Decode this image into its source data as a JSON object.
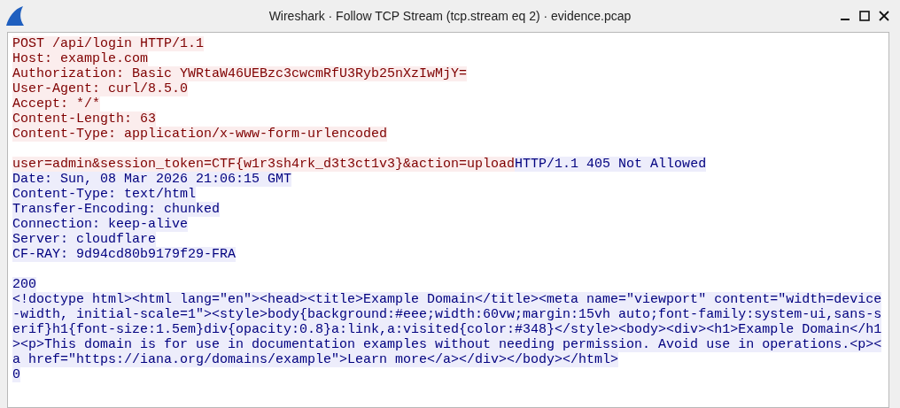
{
  "window": {
    "title": "Wireshark · Follow TCP Stream (tcp.stream eq 2) · evidence.pcap"
  },
  "stream": {
    "lines": [
      {
        "kind": "text",
        "segments": [
          {
            "kind": "client",
            "text": "POST /api/login HTTP/1.1"
          }
        ]
      },
      {
        "kind": "text",
        "segments": [
          {
            "kind": "client",
            "text": "Host: example.com"
          }
        ]
      },
      {
        "kind": "text",
        "segments": [
          {
            "kind": "client",
            "text": "Authorization: Basic YWRtaW46UEBzc3cwcmRfU3Ryb25nXzIwMjY="
          }
        ]
      },
      {
        "kind": "text",
        "segments": [
          {
            "kind": "client",
            "text": "User-Agent: curl/8.5.0"
          }
        ]
      },
      {
        "kind": "text",
        "segments": [
          {
            "kind": "client",
            "text": "Accept: */*"
          }
        ]
      },
      {
        "kind": "text",
        "segments": [
          {
            "kind": "client",
            "text": "Content-Length: 63"
          }
        ]
      },
      {
        "kind": "text",
        "segments": [
          {
            "kind": "client",
            "text": "Content-Type: application/x-www-form-urlencoded"
          }
        ]
      },
      {
        "kind": "blank"
      },
      {
        "kind": "text",
        "segments": [
          {
            "kind": "client",
            "text": "user=admin&session_token=CTF{w1r3sh4rk_d3t3ct1v3}&action=upload"
          },
          {
            "kind": "server",
            "text": "HTTP/1.1 405 Not Allowed"
          }
        ]
      },
      {
        "kind": "text",
        "segments": [
          {
            "kind": "server",
            "text": "Date: Sun, 08 Mar 2026 21:06:15 GMT"
          }
        ]
      },
      {
        "kind": "text",
        "segments": [
          {
            "kind": "server",
            "text": "Content-Type: text/html"
          }
        ]
      },
      {
        "kind": "text",
        "segments": [
          {
            "kind": "server",
            "text": "Transfer-Encoding: chunked"
          }
        ]
      },
      {
        "kind": "text",
        "segments": [
          {
            "kind": "server",
            "text": "Connection: keep-alive"
          }
        ]
      },
      {
        "kind": "text",
        "segments": [
          {
            "kind": "server",
            "text": "Server: cloudflare"
          }
        ]
      },
      {
        "kind": "text",
        "segments": [
          {
            "kind": "server",
            "text": "CF-RAY: 9d94cd80b9179f29-FRA"
          }
        ]
      },
      {
        "kind": "blank"
      },
      {
        "kind": "text",
        "segments": [
          {
            "kind": "server",
            "text": "200"
          }
        ]
      },
      {
        "kind": "text",
        "segments": [
          {
            "kind": "server",
            "text": "<!doctype html><html lang=\"en\"><head><title>Example Domain</title><meta name=\"viewport\" content=\"width=device"
          }
        ]
      },
      {
        "kind": "text",
        "segments": [
          {
            "kind": "server",
            "text": "-width, initial-scale=1\"><style>body{background:#eee;width:60vw;margin:15vh auto;font-family:system-ui,sans-s"
          }
        ]
      },
      {
        "kind": "text",
        "segments": [
          {
            "kind": "server",
            "text": "erif}h1{font-size:1.5em}div{opacity:0.8}a:link,a:visited{color:#348}</style><body><div><h1>Example Domain</h1"
          }
        ]
      },
      {
        "kind": "text",
        "segments": [
          {
            "kind": "server",
            "text": "><p>This domain is for use in documentation examples without needing permission. Avoid use in operations.<p><"
          }
        ]
      },
      {
        "kind": "text",
        "segments": [
          {
            "kind": "server",
            "text": "a href=\"https://iana.org/domains/example\">Learn more</a></div></body></html>"
          }
        ]
      },
      {
        "kind": "text",
        "segments": [
          {
            "kind": "server",
            "text": "0"
          }
        ]
      }
    ]
  }
}
